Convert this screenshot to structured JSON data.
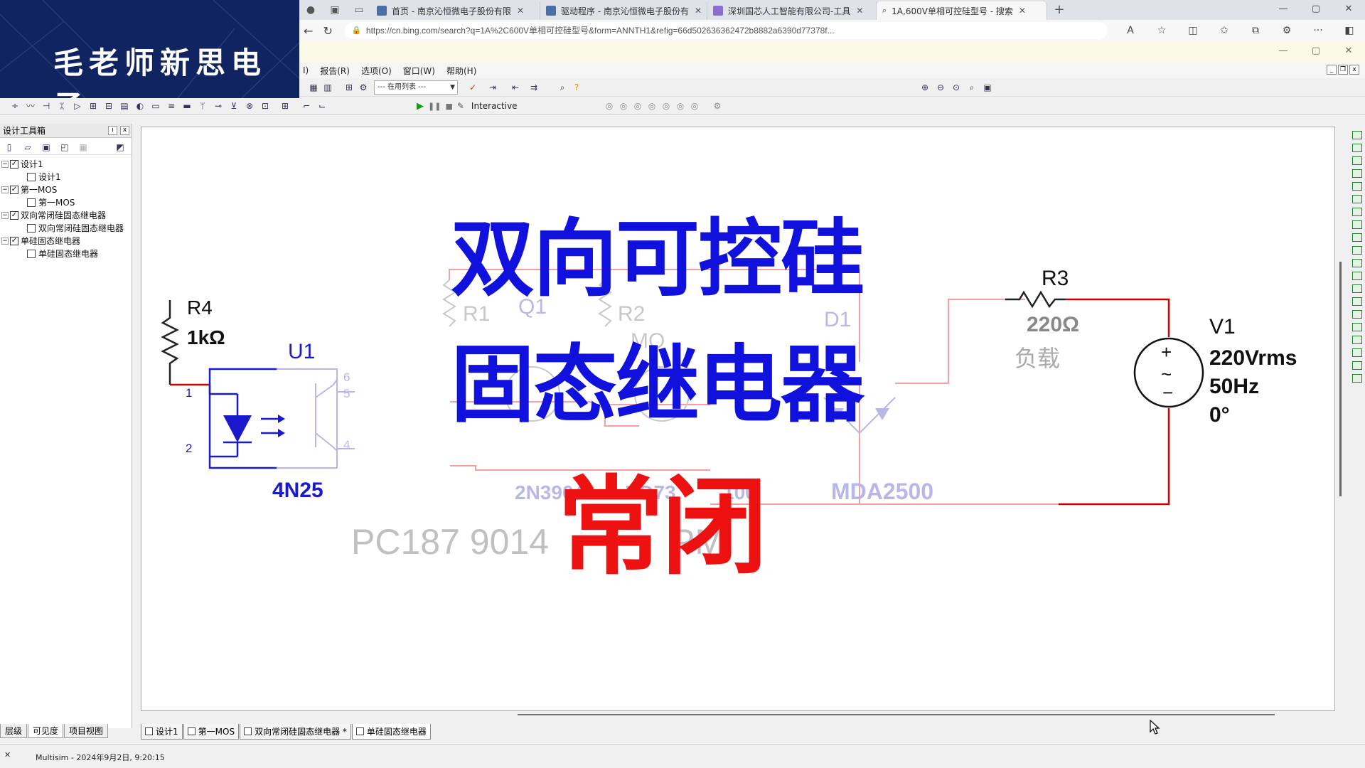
{
  "browser": {
    "tabs": [
      {
        "label": "首页 - 南京沁恒微电子股份有限"
      },
      {
        "label": "驱动程序 - 南京沁恒微电子股份有"
      },
      {
        "label": "深圳国芯人工智能有限公司-工具"
      },
      {
        "label": "1A,600V单相可控硅型号 - 搜索"
      }
    ],
    "url": "https://cn.bing.com/search?q=1A%2C600V单相可控硅型号&form=ANNTH1&refig=66d502636362472b8882a6390d77378f..."
  },
  "logo": {
    "text": "毛老师新思电子"
  },
  "menu": {
    "items": [
      "报告(R)",
      "选项(O)",
      "窗口(W)",
      "帮助(H)"
    ],
    "partial_item": "I)"
  },
  "toolbar": {
    "in_use_list": "--- 在用列表 ---",
    "interactive_label": "Interactive"
  },
  "toolbox": {
    "title": "设计工具箱",
    "tree": [
      {
        "label": "设计1",
        "child": "设计1"
      },
      {
        "label": "第一MOS",
        "child": "第一MOS"
      },
      {
        "label": "双向常闭硅固态继电器",
        "child": "双向常闭硅固态继电器"
      },
      {
        "label": "单硅固态继电器",
        "child": "单硅固态继电器"
      }
    ],
    "tabs": [
      "层级",
      "可见度",
      "项目视图"
    ]
  },
  "doc_tabs": [
    "设计1",
    "第一MOS",
    "双向常闭硅固态继电器 *",
    "单硅固态继电器"
  ],
  "status": {
    "text": "Multisim  -  2024年9月2日, 9:20:15"
  },
  "schematic": {
    "r4_name": "R4",
    "r4_value": "1kΩ",
    "u1_name": "U1",
    "u1_part": "4N25",
    "pin1": "1",
    "pin2": "2",
    "pin4": "4",
    "pin5": "5",
    "pin6": "6",
    "r1_name": "R1",
    "q1_name": "Q1",
    "r2_name": "R2",
    "q1_part": "2N3904",
    "r2_part": "RD73",
    "d1_name": "D1",
    "d1_part": "MDA2500",
    "r3_name": "R3",
    "r3_value": "220Ω",
    "load_label": "负载",
    "v1_name": "V1",
    "v1_volt": "220Vrms",
    "v1_freq": "50Hz",
    "v1_phase": "0°",
    "note_text": "PC187  9014",
    "frag_mo": "MO",
    "frag_100": "100",
    "frag_pm": "PM"
  },
  "overlay": {
    "line1": "双向可控硅",
    "line2": "固态继电器",
    "line3": "常闭"
  },
  "colors": {
    "wire_red": "#cc0000",
    "part_blue": "#1a1acc",
    "title_blue": "#1111dd",
    "title_red": "#ee1111",
    "logo_bg": "#0f2460"
  }
}
